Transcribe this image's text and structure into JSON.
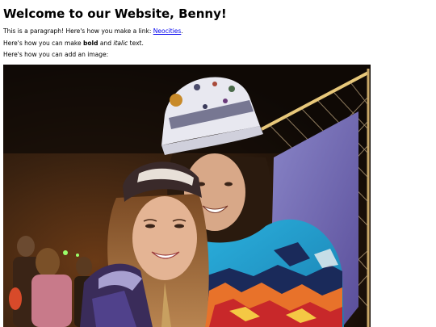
{
  "heading": "Welcome to our Website, Benny!",
  "para1": {
    "before": "This is a paragraph! Here's how you make a link: ",
    "link_text": "Neocities",
    "after": "."
  },
  "para2": {
    "before": "Here's how you can make ",
    "bold": "bold",
    "middle": " and ",
    "italic": "italic",
    "after": " text."
  },
  "para3": "Here's how you can add an image:",
  "colors": {
    "link": "#0000ee",
    "text": "#000000",
    "background": "#ffffff"
  }
}
